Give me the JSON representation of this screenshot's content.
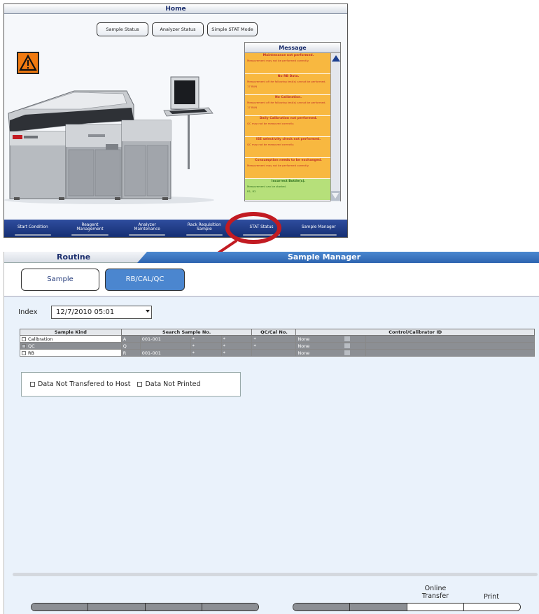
{
  "home": {
    "title": "Home",
    "tabs": [
      "Sample Status",
      "Analyzer Status",
      "Simple STAT Mode"
    ],
    "messages_header": "Message",
    "messages": [
      {
        "title": "Maintenance not performed.",
        "detail": "Measurement may not be performed correctly.",
        "extra": ""
      },
      {
        "title": "No RB Data.",
        "detail": "Measurement of the following test(s) cannot be performed.",
        "extra": "17 BUN"
      },
      {
        "title": "No Calibration.",
        "detail": "Measurement of the following test(s) cannot be performed.",
        "extra": "17 BUN"
      },
      {
        "title": "Daily Calibration not performed.",
        "detail": "QC may not be measured correctly.",
        "extra": ""
      },
      {
        "title": "ISE selectivity check not performed.",
        "detail": "QC may not be measured correctly.",
        "extra": ""
      },
      {
        "title": "Consumption needs to be exchanged.",
        "detail": "Measurement may not be performed correctly.",
        "extra": ""
      },
      {
        "title": "Incorrect Bottle(s).",
        "detail": "Measurement can be started.",
        "extra": "R1, R2"
      }
    ],
    "bottom_bar": [
      "Start Condition",
      "Reagent\nManagement",
      "Analyzer\nMaintenance",
      "Rack Requisition\nSample",
      "STAT Status",
      "Sample Manager"
    ],
    "brand_text": "BECKMAN COULTER"
  },
  "sample_manager": {
    "routine_label": "Routine",
    "title": "Sample Manager",
    "tabs": {
      "sample": "Sample",
      "rb_cal_qc": "RB/CAL/QC"
    },
    "index_label": "Index",
    "index_value": "12/7/2010 05:01",
    "table": {
      "headers": [
        "Sample Kind",
        "Search Sample No.",
        "QC/Cal No.",
        "Control/Calibrator ID"
      ],
      "rows": [
        {
          "kind": "Calibration",
          "code": "A",
          "no": "001-001",
          "s1": "*",
          "s2": "*",
          "qc": "*",
          "id": "None"
        },
        {
          "kind": "QC",
          "code": "Q",
          "no": "",
          "s1": "*",
          "s2": "*",
          "qc": "*",
          "id": "None"
        },
        {
          "kind": "RB",
          "code": "R",
          "no": "001-001",
          "s1": "*",
          "s2": "*",
          "qc": "",
          "id": "None"
        }
      ]
    },
    "filters": [
      "Data Not Transfered to Host",
      "Data Not Printed"
    ],
    "online_transfer": "Online\nTransfer",
    "print": "Print"
  },
  "colors": {
    "accent_blue": "#2d64b0",
    "highlight_red": "#c21b22",
    "message_orange": "#f8b840",
    "message_green": "#b6e07a"
  }
}
